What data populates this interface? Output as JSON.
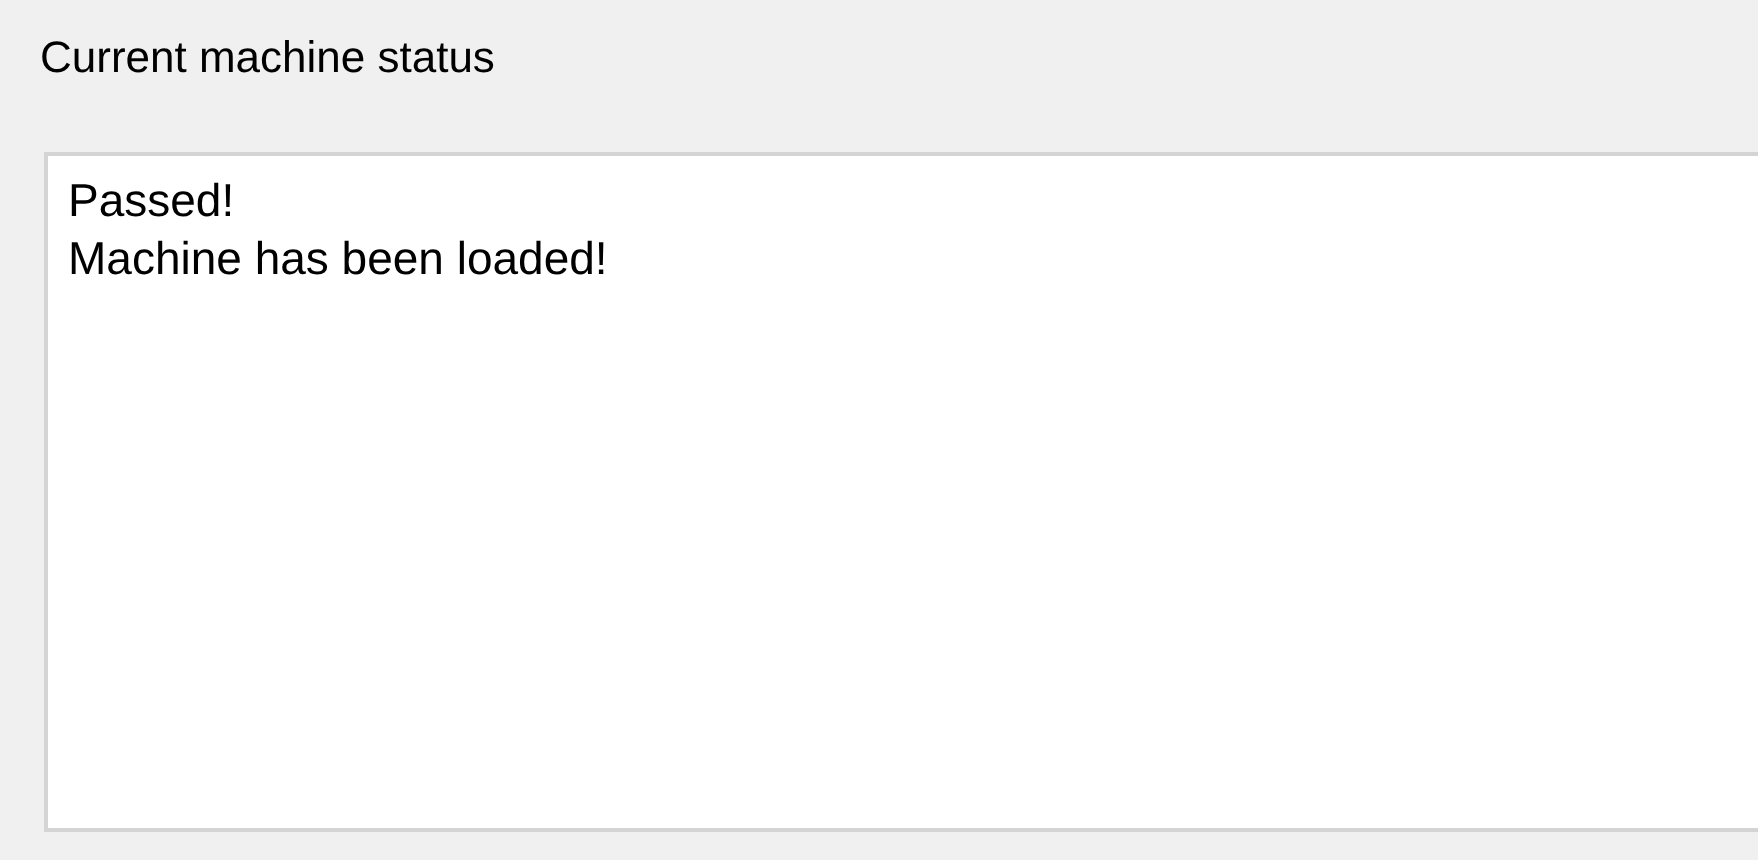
{
  "group_label": "Current machine status",
  "status_box": {
    "lines": [
      "Passed!",
      "Machine has been loaded!"
    ]
  }
}
